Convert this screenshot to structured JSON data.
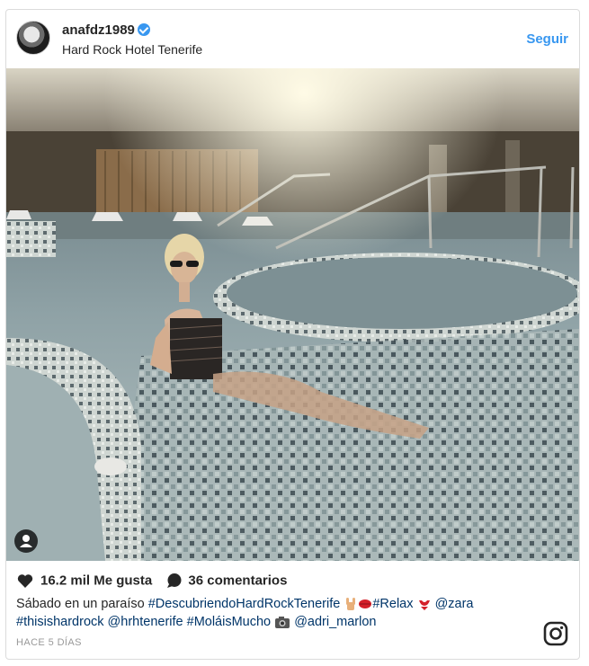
{
  "post": {
    "username": "anafdz1989",
    "location": "Hard Rock Hotel Tenerife",
    "follow_label": "Seguir",
    "likes": "16.2 mil Me gusta",
    "comments": "36 comentarios",
    "caption_line1_prefix": "Sábado en un paraíso ",
    "hashtag1": "#DescubriendoHardRockTenerife",
    "hashtag2": "#Relax",
    "mention1": "@zara",
    "hashtag3": "#thisishardrock",
    "mention2": "@hrhtenerife",
    "hashtag4": "#MoláisMucho",
    "mention3": "@adri_marlon",
    "time": "HACE 5 DÍAS"
  },
  "icons": {
    "verified": "verified-badge-icon",
    "like": "heart-icon",
    "comment": "comment-bubble-icon",
    "user_tag": "user-tag-icon",
    "brand": "instagram-icon"
  },
  "colors": {
    "link": "#3897f0",
    "hashtag": "#003569",
    "text": "#262626",
    "muted": "#999999"
  }
}
